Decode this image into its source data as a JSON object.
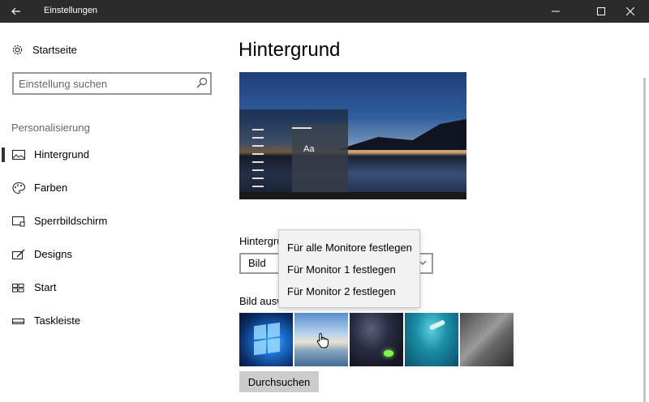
{
  "window": {
    "title": "Einstellungen"
  },
  "sidebar": {
    "home_label": "Startseite",
    "search_placeholder": "Einstellung suchen",
    "section_label": "Personalisierung",
    "items": [
      {
        "label": "Hintergrund",
        "icon": "picture-icon",
        "active": true
      },
      {
        "label": "Farben",
        "icon": "palette-icon",
        "active": false
      },
      {
        "label": "Sperrbildschirm",
        "icon": "lock-screen-icon",
        "active": false
      },
      {
        "label": "Designs",
        "icon": "brush-icon",
        "active": false
      },
      {
        "label": "Start",
        "icon": "start-icon",
        "active": false
      },
      {
        "label": "Taskleiste",
        "icon": "taskbar-icon",
        "active": false
      }
    ]
  },
  "main": {
    "title": "Hintergrund",
    "preview_text": "Aa",
    "background_label": "Hintergru",
    "background_value": "Bild",
    "picture_label": "Bild ausw",
    "browse_label": "Durchsuchen"
  },
  "flyout": {
    "items": [
      "Für alle Monitore festlegen",
      "Für Monitor 1 festlegen",
      "Für Monitor 2 festlegen"
    ]
  },
  "colors": {
    "titlebar": "#2b2b2b",
    "button": "#cccccc",
    "flyout": "#f2f2f2"
  }
}
